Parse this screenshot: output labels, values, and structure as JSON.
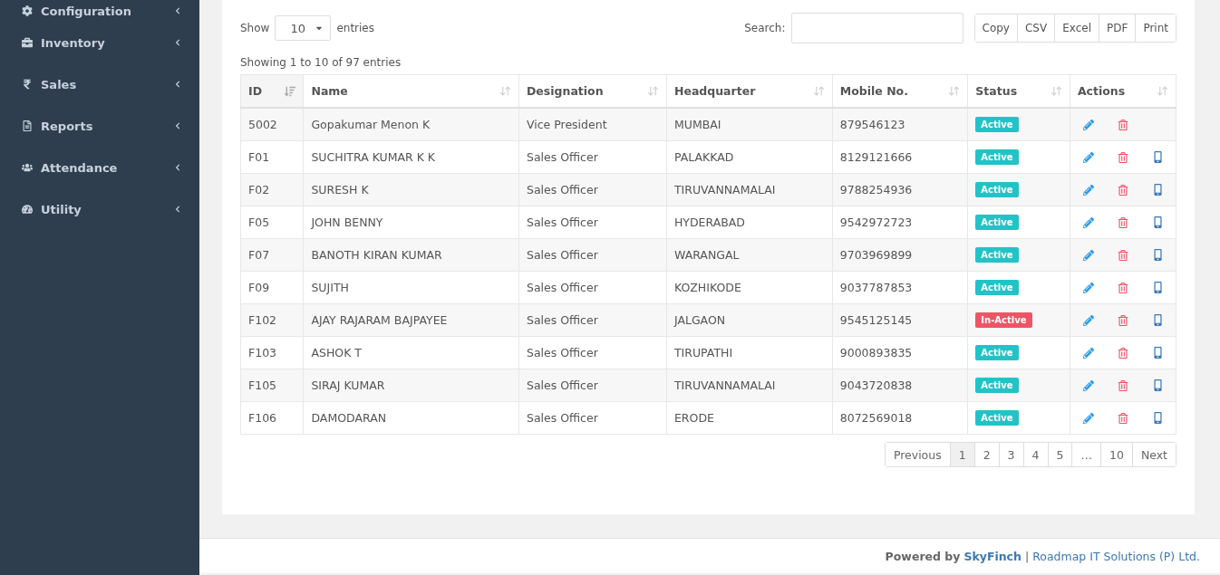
{
  "sidebar": {
    "items": [
      {
        "label": "Configuration",
        "kind": "gear"
      },
      {
        "label": "Inventory",
        "kind": "briefcase"
      },
      {
        "label": "Sales",
        "kind": "rupee"
      },
      {
        "label": "Reports",
        "kind": "file"
      },
      {
        "label": "Attendance",
        "kind": "users"
      },
      {
        "label": "Utility",
        "kind": "gauge"
      }
    ]
  },
  "controls": {
    "show_label": "Show",
    "page_size": "10",
    "entries_label": "entries",
    "search_label": "Search:",
    "export_buttons": [
      "Copy",
      "CSV",
      "Excel",
      "PDF",
      "Print"
    ]
  },
  "info": "Showing 1 to 10 of 97 entries",
  "table": {
    "columns": [
      {
        "label": "ID",
        "sorted": true
      },
      {
        "label": "Name",
        "sorted": false
      },
      {
        "label": "Designation",
        "sorted": false
      },
      {
        "label": "Headquarter",
        "sorted": false
      },
      {
        "label": "Mobile No.",
        "sorted": false
      },
      {
        "label": "Status",
        "sorted": false
      },
      {
        "label": "Actions",
        "sorted": false
      }
    ],
    "rows": [
      {
        "id": "5002",
        "name": "Gopakumar Menon K",
        "designation": "Vice President",
        "headquarter": "MUMBAI",
        "mobile": "879546123",
        "status": "Active",
        "kind": "active",
        "mobile_action": false
      },
      {
        "id": "F01",
        "name": "SUCHITRA KUMAR K K",
        "designation": "Sales Officer",
        "headquarter": "PALAKKAD",
        "mobile": "8129121666",
        "status": "Active",
        "kind": "active",
        "mobile_action": true
      },
      {
        "id": "F02",
        "name": "SURESH K",
        "designation": "Sales Officer",
        "headquarter": "TIRUVANNAMALAI",
        "mobile": "9788254936",
        "status": "Active",
        "kind": "active",
        "mobile_action": true
      },
      {
        "id": "F05",
        "name": "JOHN BENNY",
        "designation": "Sales Officer",
        "headquarter": "HYDERABAD",
        "mobile": "9542972723",
        "status": "Active",
        "kind": "active",
        "mobile_action": true
      },
      {
        "id": "F07",
        "name": "BANOTH KIRAN KUMAR",
        "designation": "Sales Officer",
        "headquarter": "WARANGAL",
        "mobile": "9703969899",
        "status": "Active",
        "kind": "active",
        "mobile_action": true
      },
      {
        "id": "F09",
        "name": "SUJITH",
        "designation": "Sales Officer",
        "headquarter": "KOZHIKODE",
        "mobile": "9037787853",
        "status": "Active",
        "kind": "active",
        "mobile_action": true
      },
      {
        "id": "F102",
        "name": "AJAY RAJARAM BAJPAYEE",
        "designation": "Sales Officer",
        "headquarter": "JALGAON",
        "mobile": "9545125145",
        "status": "In-Active",
        "kind": "inactive",
        "mobile_action": true
      },
      {
        "id": "F103",
        "name": "ASHOK T",
        "designation": "Sales Officer",
        "headquarter": "TIRUPATHI",
        "mobile": "9000893835",
        "status": "Active",
        "kind": "active",
        "mobile_action": true
      },
      {
        "id": "F105",
        "name": "SIRAJ KUMAR",
        "designation": "Sales Officer",
        "headquarter": "TIRUVANNAMALAI",
        "mobile": "9043720838",
        "status": "Active",
        "kind": "active",
        "mobile_action": true
      },
      {
        "id": "F106",
        "name": "DAMODARAN",
        "designation": "Sales Officer",
        "headquarter": "ERODE",
        "mobile": "8072569018",
        "status": "Active",
        "kind": "active",
        "mobile_action": true
      }
    ]
  },
  "pagination": [
    {
      "label": "Previous",
      "selected": false
    },
    {
      "label": "1",
      "selected": true
    },
    {
      "label": "2",
      "selected": false
    },
    {
      "label": "3",
      "selected": false
    },
    {
      "label": "4",
      "selected": false
    },
    {
      "label": "5",
      "selected": false
    },
    {
      "label": "…",
      "selected": false
    },
    {
      "label": "10",
      "selected": false
    },
    {
      "label": "Next",
      "selected": false
    }
  ],
  "footer": {
    "text": "**Powered by** ",
    "brand": "SkyFinch",
    "separator": "|",
    "company": "Roadmap IT Solutions (P) Ltd."
  }
}
